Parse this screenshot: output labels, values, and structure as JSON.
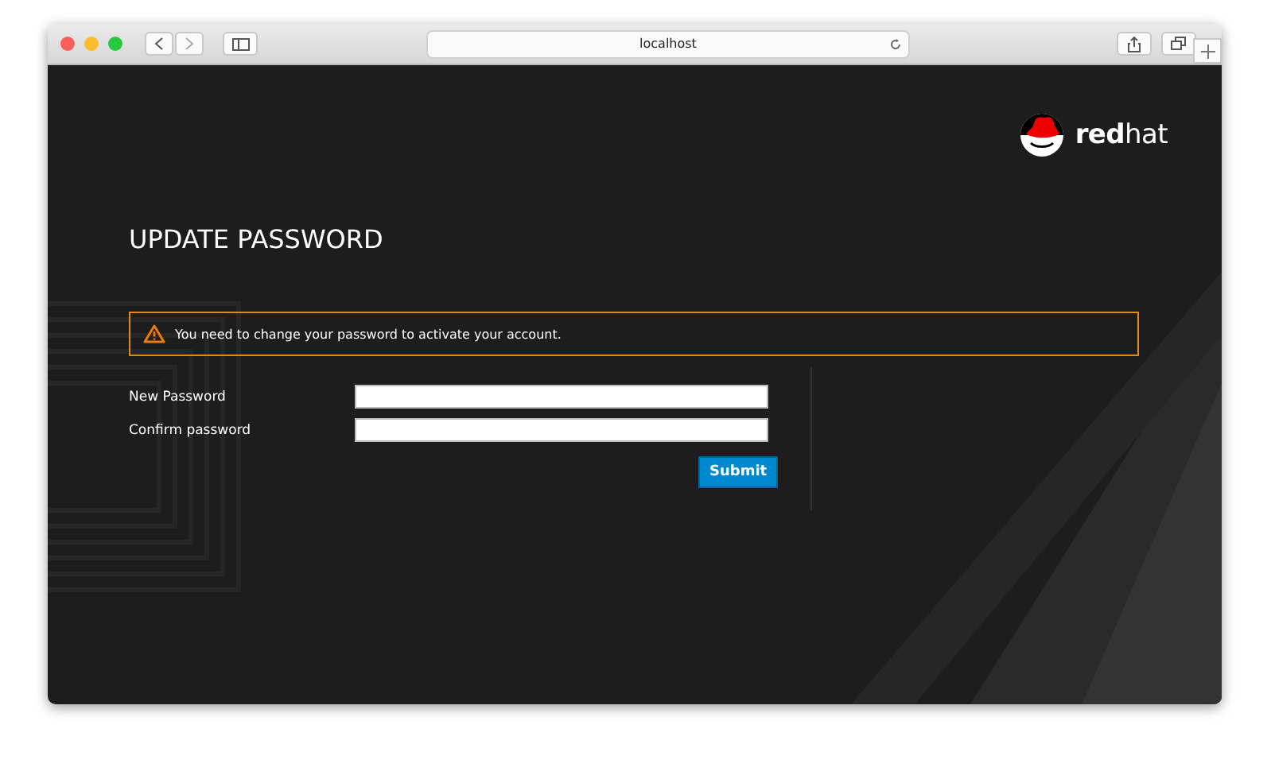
{
  "browser": {
    "address": "localhost"
  },
  "logo": "**red**hat",
  "title": "UPDATE PASSWORD",
  "alert": {
    "kind": "warning",
    "text": "You need to change your password to activate your account."
  },
  "fields": [
    {
      "label": "New Password"
    },
    {
      "label": "Confirm password"
    }
  ],
  "submit": "Submit"
}
